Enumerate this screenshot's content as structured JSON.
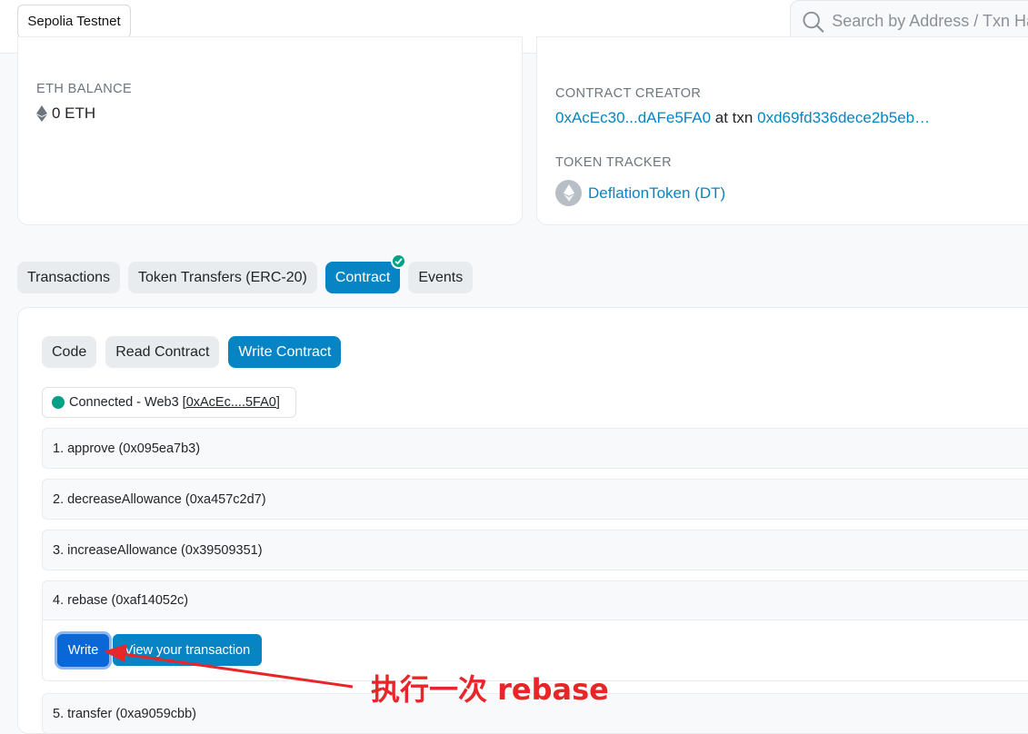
{
  "header": {
    "network": "Sepolia Testnet",
    "search_placeholder": "Search by Address / Txn Hash / Block / Token"
  },
  "overview": {
    "eth_balance_label": "ETH BALANCE",
    "eth_balance_value": "0 ETH"
  },
  "more_info": {
    "creator_label": "CONTRACT CREATOR",
    "creator_address": "0xAcEc30...dAFe5FA0",
    "at_txn_text": "at txn",
    "creator_txn": "0xd69fd336dece2b5eb…",
    "token_tracker_label": "TOKEN TRACKER",
    "token_name": "DeflationToken (DT)"
  },
  "tabs": [
    {
      "label": "Transactions",
      "active": false
    },
    {
      "label": "Token Transfers (ERC-20)",
      "active": false
    },
    {
      "label": "Contract",
      "active": true
    },
    {
      "label": "Events",
      "active": false
    }
  ],
  "subtabs": [
    {
      "label": "Code",
      "active": false
    },
    {
      "label": "Read Contract",
      "active": false
    },
    {
      "label": "Write Contract",
      "active": true
    }
  ],
  "connection": {
    "status": "Connected - Web3",
    "address": "[0xAcEc....5FA0]"
  },
  "functions": [
    {
      "label": "1. approve (0x095ea7b3)"
    },
    {
      "label": "2. decreaseAllowance (0xa457c2d7)"
    },
    {
      "label": "3. increaseAllowance (0x39509351)"
    },
    {
      "label": "4. rebase (0xaf14052c)"
    },
    {
      "label": "5. transfer (0xa9059cbb)"
    }
  ],
  "rebase_actions": {
    "write_label": "Write",
    "view_tx_label": "View your transaction"
  },
  "annotation": {
    "text": "执行一次 rebase",
    "color": "#e8262a"
  },
  "colors": {
    "accent": "#0784c3",
    "connected": "#00a186"
  }
}
